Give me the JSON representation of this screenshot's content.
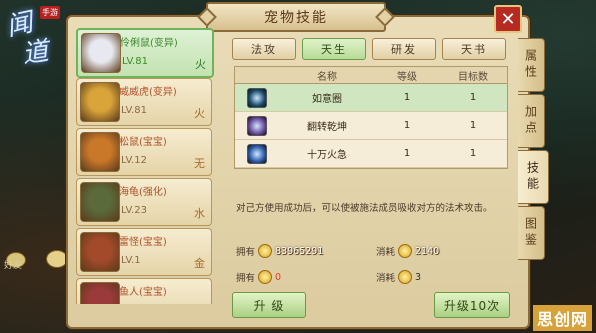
{
  "game_logo": {
    "text_a": "闻",
    "text_b": "道",
    "tag": "手游"
  },
  "chat": {
    "label": "好友"
  },
  "panel": {
    "title": "宠物技能",
    "close": "✕"
  },
  "pets": [
    {
      "name": "伶俐鼠(变异)",
      "level": "LV.81",
      "element": "火",
      "selected": true,
      "color": "#e8e8f0"
    },
    {
      "name": "威威虎(变异)",
      "level": "LV.81",
      "element": "火",
      "selected": false,
      "color": "#d9a43a"
    },
    {
      "name": "松鼠(宝宝)",
      "level": "LV.12",
      "element": "无",
      "selected": false,
      "color": "#c9782a"
    },
    {
      "name": "海龟(强化)",
      "level": "LV.23",
      "element": "水",
      "selected": false,
      "color": "#5a6a3a"
    },
    {
      "name": "雷怪(宝宝)",
      "level": "LV.1",
      "element": "金",
      "selected": false,
      "color": "#a24a2a"
    },
    {
      "name": "鱼人(宝宝)",
      "level": "",
      "element": "",
      "selected": false,
      "color": "#9a3a3a"
    }
  ],
  "tabs": [
    {
      "label": "法攻",
      "active": false
    },
    {
      "label": "天生",
      "active": true
    },
    {
      "label": "研发",
      "active": false
    },
    {
      "label": "天书",
      "active": false
    }
  ],
  "table": {
    "headers": [
      "",
      "名称",
      "等级",
      "目标数"
    ],
    "rows": [
      {
        "name": "如意圈",
        "level": "1",
        "targets": "1",
        "selected": true,
        "icon_color": "#1a4a6a"
      },
      {
        "name": "翻转乾坤",
        "level": "1",
        "targets": "1",
        "selected": false,
        "icon_color": "#6a4a9a"
      },
      {
        "name": "十万火急",
        "level": "1",
        "targets": "1",
        "selected": false,
        "icon_color": "#2a5aa8"
      }
    ]
  },
  "description": "对己方使用成功后，可以使被施法成员吸收对方的法术攻击。",
  "stats": {
    "own_label_1": "拥有",
    "own_value_1": "83965291",
    "cost_label_1": "消耗",
    "cost_value_1": "2140",
    "own_label_2": "拥有",
    "own_value_2": "0",
    "cost_label_2": "消耗",
    "cost_value_2": "3"
  },
  "buttons": {
    "upgrade": "升 级",
    "upgrade10": "升级10次"
  },
  "side_tabs": [
    {
      "label": "属性",
      "active": false
    },
    {
      "label": "加点",
      "active": false
    },
    {
      "label": "技能",
      "active": true
    },
    {
      "label": "图鉴",
      "active": false
    }
  ],
  "watermark": "思创网"
}
